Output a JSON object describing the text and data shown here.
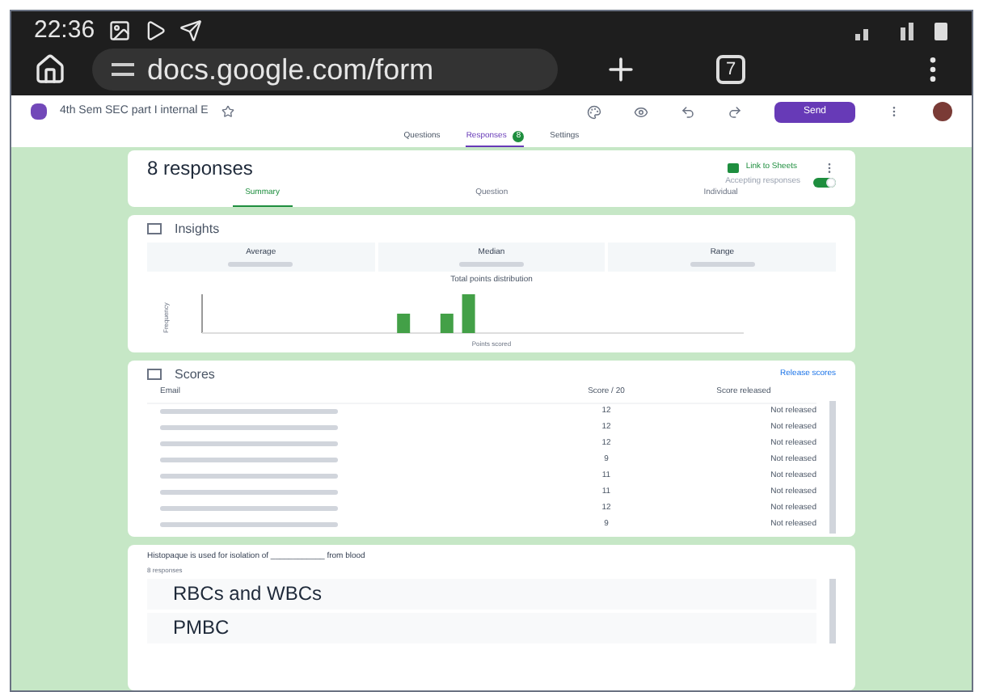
{
  "status_bar": {
    "time": "22:36"
  },
  "browser": {
    "url": "docs.google.com/form",
    "tab_count": "7"
  },
  "form_header": {
    "title": "4th Sem SEC part I internal E",
    "send": "Send",
    "tabs": [
      {
        "label": "Questions",
        "selected": false
      },
      {
        "label": "Responses",
        "selected": true,
        "badge": "8"
      },
      {
        "label": "Settings",
        "selected": false
      }
    ]
  },
  "summary_card": {
    "title": "8 responses",
    "link": "Link to Sheets",
    "accepting": {
      "label": "Accepting responses",
      "on": true
    },
    "tabs": [
      {
        "label": "Summary",
        "selected": true
      },
      {
        "label": "Question",
        "selected": false
      },
      {
        "label": "Individual",
        "selected": false
      }
    ]
  },
  "insights": {
    "title": "Insights",
    "stats": [
      {
        "label": "Average"
      },
      {
        "label": "Median"
      },
      {
        "label": "Range"
      }
    ],
    "chart_title": "Total points distribution",
    "y_label": "Frequency",
    "x_label": "Points scored"
  },
  "scores": {
    "title": "Scores",
    "action": "Release scores",
    "columns": [
      "Email",
      "Score / 20",
      "Score released"
    ],
    "rows": [
      {
        "score": "12",
        "status": "Not released"
      },
      {
        "score": "12",
        "status": "Not released"
      },
      {
        "score": "12",
        "status": "Not released"
      },
      {
        "score": "9",
        "status": "Not released"
      },
      {
        "score": "11",
        "status": "Not released"
      },
      {
        "score": "11",
        "status": "Not released"
      },
      {
        "score": "12",
        "status": "Not released"
      },
      {
        "score": "9",
        "status": "Not released"
      }
    ]
  },
  "question": {
    "text": "Histopaque is used for isolation of ____________ from blood",
    "count": "8 responses",
    "answers": [
      "RBCs and WBCs",
      "PMBC"
    ]
  }
}
